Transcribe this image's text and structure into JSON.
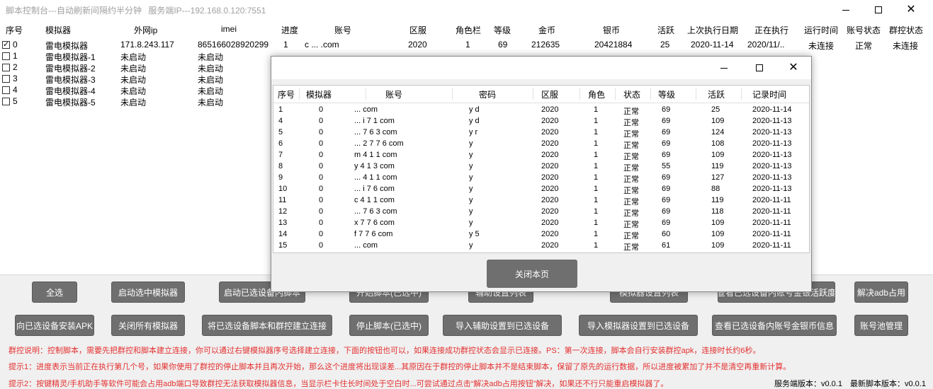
{
  "window": {
    "title": "脚本控制台---自动刷新间隔约半分钟",
    "server_ip": "服务端IP---192.168.0.120:7551"
  },
  "grid": {
    "headers": [
      "序号",
      "模拟器",
      "外网ip",
      "imei",
      "进度",
      "账号",
      "区服",
      "角色栏",
      "等级",
      "金币",
      "银币",
      "活跃",
      "上次执行日期",
      "正在执行",
      "运行时间",
      "账号状态",
      "群控状态"
    ],
    "rows": [
      {
        "no": "0",
        "checked": true,
        "name": "雷电模拟器",
        "ip": "171.8.243.117",
        "imei": "865166028920299",
        "progress": "1",
        "account": "c  ...  .com",
        "server": "2020",
        "role": "1",
        "level": "69",
        "gold": "212635",
        "silver": "20421884",
        "active": "25",
        "last_date": "2020-11-14",
        "running": "2020/11/..",
        "run_time": "未连接",
        "acc_status": "正常",
        "ctl_status": "未连接"
      },
      {
        "no": "1",
        "checked": false,
        "name": "雷电模拟器-1",
        "ip": "未启动",
        "imei": "未启动"
      },
      {
        "no": "2",
        "checked": false,
        "name": "雷电模拟器-2",
        "ip": "未启动",
        "imei": "未启动"
      },
      {
        "no": "3",
        "checked": false,
        "name": "雷电模拟器-3",
        "ip": "未启动",
        "imei": "未启动"
      },
      {
        "no": "4",
        "checked": false,
        "name": "雷电模拟器-4",
        "ip": "未启动",
        "imei": "未启动"
      },
      {
        "no": "5",
        "checked": false,
        "name": "雷电模拟器-5",
        "ip": "未启动",
        "imei": "未启动"
      }
    ]
  },
  "buttons_row1": [
    "全选",
    "启动选中模拟器",
    "启动已选设备内脚本",
    "开始脚本(已选中)",
    "辅助设置列表",
    "模拟器设置列表",
    "查看已选设备内账号金银活跃度",
    "解决adb占用"
  ],
  "buttons_row2": [
    "向已选设备安装APK",
    "关闭所有模拟器",
    "将已选设备脚本和群控建立连接",
    "停止脚本(已选中)",
    "导入辅助设置到已选设备",
    "导入模拟器设置到已选设备",
    "查看已选设备内账号金银币信息",
    "账号池管理"
  ],
  "notes": [
    "群控说明：控制脚本，需要先把群控和脚本建立连接，你可以通过右键模拟器序号选择建立连接，下面的按钮也可以，如果连接成功群控状态会显示已连接。PS：第一次连接，脚本会自行安装群控apk，连接时长约6秒。",
    "提示1：进度表示当前正在执行第几个号，如果你使用了群控的停止脚本并且再次开始，那么这个进度将出现误差...其原因在于群控的停止脚本并不是结束脚本，保留了原先的运行数据，所以进度被累加了并不是清空再重新计算。",
    "提示2：按键精灵/手机助手等软件可能会占用adb端口导致群控无法获取模拟器信息，当显示栏卡住长时间处于空白时...可尝试通过点击“解决adb占用按钮”解决，如果还不行只能重启模拟器了。"
  ],
  "version": {
    "server": "服务端版本：v0.0.1",
    "latest": "最新脚本版本：v0.0.1"
  },
  "dialog": {
    "headers": [
      "序号",
      "模拟器",
      "账号",
      "密码",
      "区服",
      "角色",
      "状态",
      "等级",
      "活跃",
      "记录时间"
    ],
    "rows": [
      [
        "1",
        "0",
        "...  com",
        "y  d",
        "2020",
        "1",
        "正常",
        "69",
        "25",
        "2020-11-14"
      ],
      [
        "4",
        "0",
        "...  i 7 1  com",
        "y  d",
        "2020",
        "1",
        "正常",
        "69",
        "109",
        "2020-11-13"
      ],
      [
        "5",
        "0",
        "...  7 6 3  com",
        "y  r",
        "2020",
        "1",
        "正常",
        "69",
        "124",
        "2020-11-13"
      ],
      [
        "6",
        "0",
        "...  2 7 7 6  com",
        "y",
        "2020",
        "1",
        "正常",
        "69",
        "108",
        "2020-11-13"
      ],
      [
        "7",
        "0",
        "m  4 1 1  com",
        "y",
        "2020",
        "1",
        "正常",
        "69",
        "109",
        "2020-11-13"
      ],
      [
        "8",
        "0",
        "y  4 1 3  com",
        "y",
        "2020",
        "1",
        "正常",
        "55",
        "119",
        "2020-11-13"
      ],
      [
        "9",
        "0",
        "...  4 1 1  com",
        "y",
        "2020",
        "1",
        "正常",
        "69",
        "127",
        "2020-11-13"
      ],
      [
        "10",
        "0",
        "...  i 7 6  com",
        "y",
        "2020",
        "1",
        "正常",
        "69",
        "88",
        "2020-11-13"
      ],
      [
        "11",
        "0",
        "c  4 1 1  com",
        "y",
        "2020",
        "1",
        "正常",
        "69",
        "119",
        "2020-11-11"
      ],
      [
        "12",
        "0",
        "...  7 6 3  com",
        "y",
        "2020",
        "1",
        "正常",
        "69",
        "118",
        "2020-11-11"
      ],
      [
        "13",
        "0",
        "x  7 7 6  com",
        "y",
        "2020",
        "1",
        "正常",
        "69",
        "109",
        "2020-11-11"
      ],
      [
        "14",
        "0",
        "f  7 7 6  com",
        "y  5",
        "2020",
        "1",
        "正常",
        "60",
        "109",
        "2020-11-11"
      ],
      [
        "15",
        "0",
        "...  com",
        "y",
        "2020",
        "1",
        "正常",
        "61",
        "109",
        "2020-11-11"
      ]
    ],
    "close_label": "关闭本页"
  }
}
